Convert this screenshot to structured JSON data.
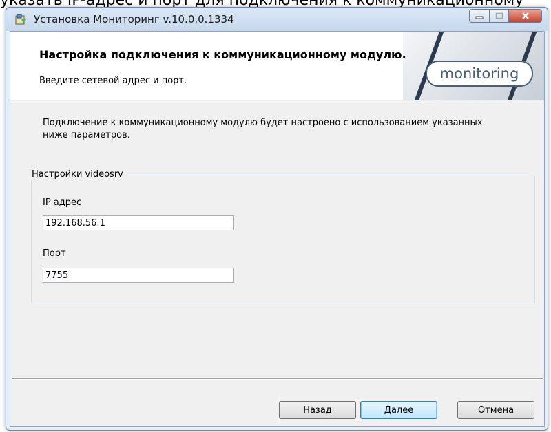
{
  "background_text": "указать IP-адрес и порт для подключения к коммуникационному",
  "window": {
    "title": "Установка Мониторинг v.10.0.0.1334"
  },
  "banner": {
    "title": "Настройка подключения к коммуникационному модулю.",
    "subtitle": "Введите сетевой адрес и порт.",
    "logo_text": "monitoring"
  },
  "description": "Подключение к коммуникационному модулю будет настроено с использованием указанных ниже параметров.",
  "group": {
    "legend": "Настройки videosrv",
    "ip_label": "IP адрес",
    "ip_value": "192.168.56.1",
    "port_label": "Порт",
    "port_value": "7755"
  },
  "buttons": {
    "back": "Назад",
    "next": "Далее",
    "cancel": "Отмена"
  },
  "colors": {
    "accent": "#4a5f78",
    "close_button": "#c8432f"
  }
}
